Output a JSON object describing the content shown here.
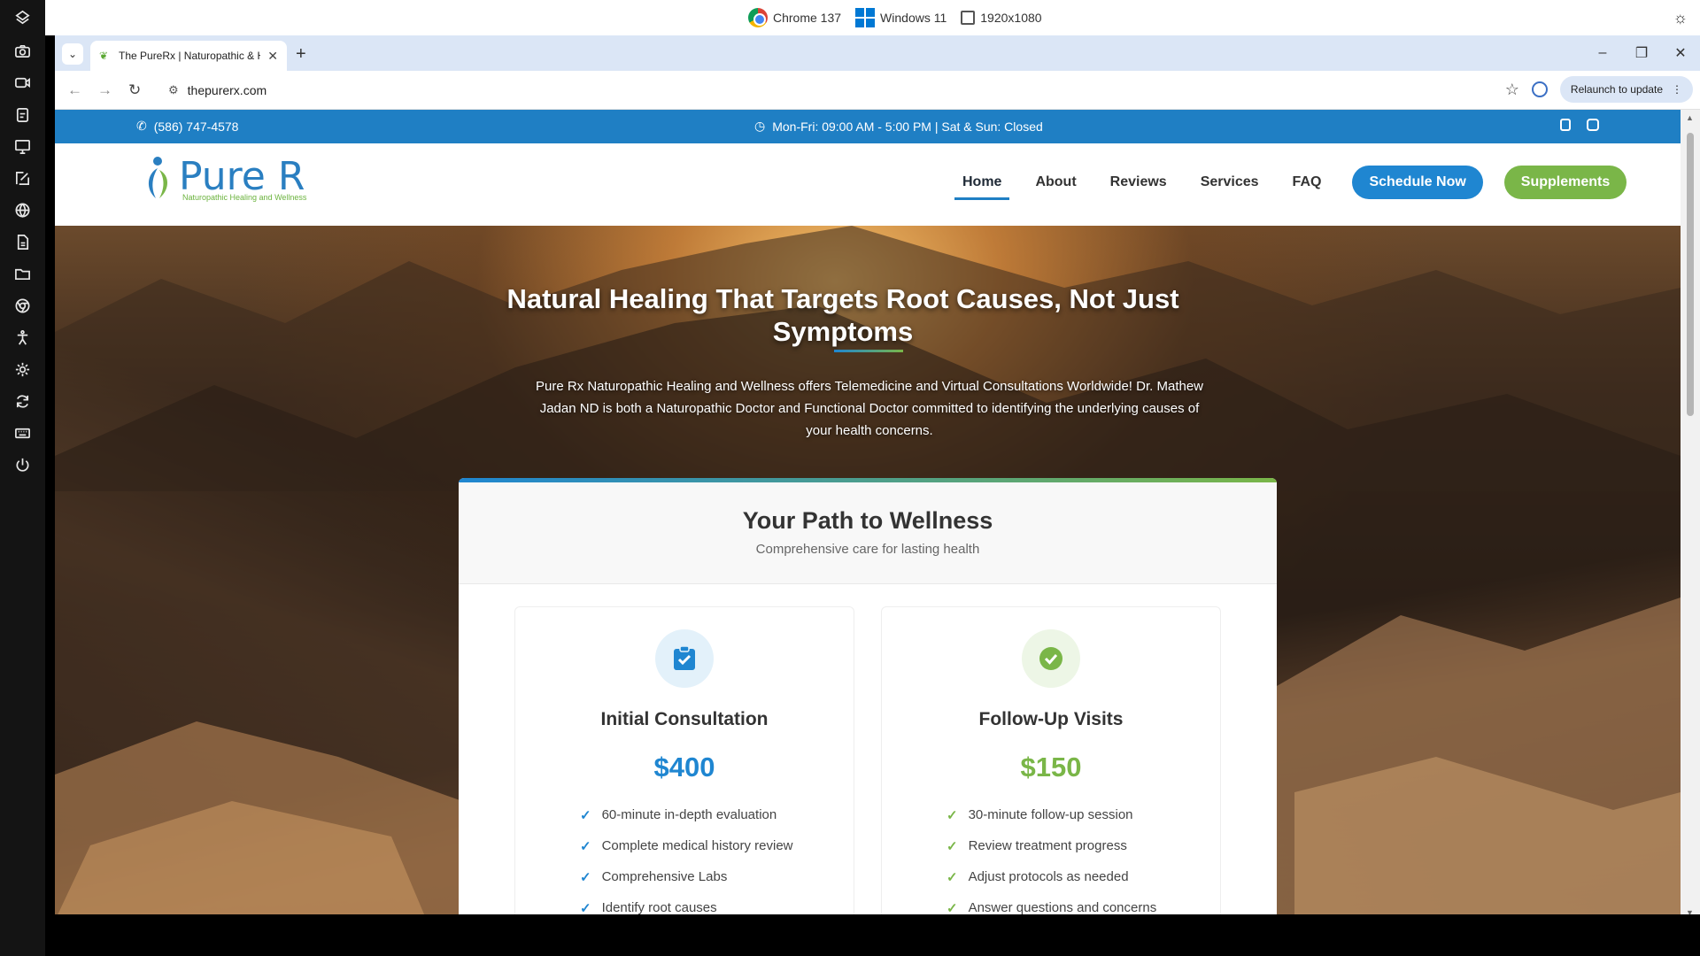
{
  "host": {
    "browser_label": "Chrome 137",
    "os_label": "Windows 11",
    "resolution_label": "1920x1080",
    "sidebar_icons": [
      "logo-icon",
      "camera-icon",
      "video-icon",
      "clipboard-icon",
      "monitor-icon",
      "edit-icon",
      "globe-icon",
      "file-icon",
      "folder-icon",
      "chrome-icon",
      "accessibility-icon",
      "settings-icon",
      "sync-icon",
      "keyboard-icon",
      "power-icon"
    ]
  },
  "browser": {
    "tab_title": "The PureRx | Naturopathic & H",
    "url": "thepurerx.com",
    "relaunch_label": "Relaunch to update"
  },
  "site": {
    "topbar": {
      "phone": "(586) 747-4578",
      "hours": "Mon-Fri: 09:00 AM - 5:00 PM | Sat & Sun: Closed"
    },
    "logo": {
      "name": "Pure R",
      "tagline": "Naturopathic Healing and Wellness"
    },
    "nav": [
      {
        "label": "Home",
        "active": true
      },
      {
        "label": "About"
      },
      {
        "label": "Reviews"
      },
      {
        "label": "Services"
      },
      {
        "label": "FAQ"
      }
    ],
    "schedule_label": "Schedule Now",
    "supplements_label": "Supplements",
    "colors": {
      "primary": "#1f86d1",
      "secondary": "#7ab648"
    },
    "hero": {
      "title": "Natural Healing That Targets Root Causes, Not Just Symptoms",
      "text": "Pure Rx Naturopathic Healing and Wellness offers Telemedicine and Virtual Consultations Worldwide! Dr. Mathew Jadan ND is both a Naturopathic Doctor and Functional Doctor committed to identifying the underlying causes of your health concerns."
    },
    "wellness": {
      "title": "Your Path to Wellness",
      "subtitle": "Comprehensive care for lasting health",
      "plans": [
        {
          "icon": "clipboard-check-icon",
          "name": "Initial Consultation",
          "price": "$400",
          "features": [
            "60-minute in-depth evaluation",
            "Complete medical history review",
            "Comprehensive Labs",
            "Identify root causes"
          ]
        },
        {
          "icon": "check-circle-icon",
          "name": "Follow-Up Visits",
          "price": "$150",
          "features": [
            "30-minute follow-up session",
            "Review treatment progress",
            "Adjust protocols as needed",
            "Answer questions and concerns"
          ]
        }
      ]
    }
  }
}
